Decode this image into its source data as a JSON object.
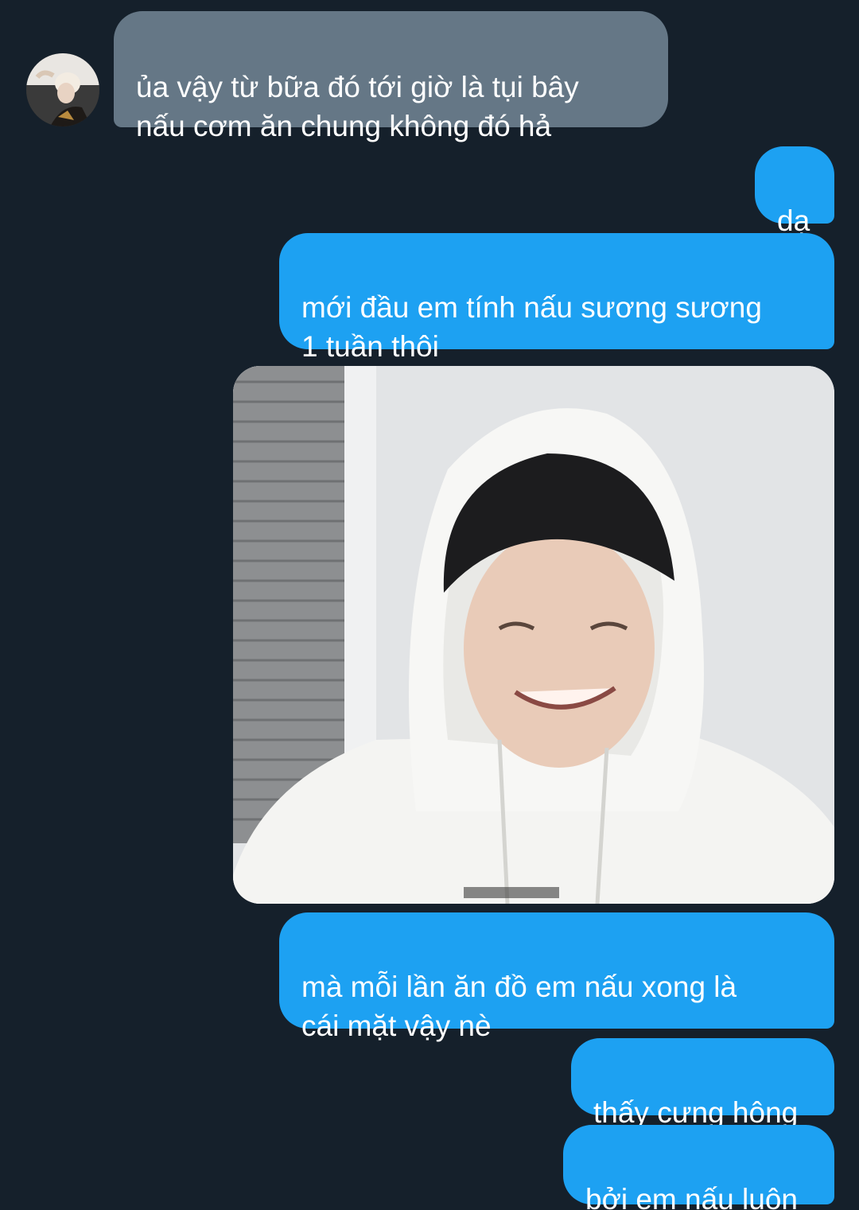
{
  "conversation": {
    "incoming": [
      {
        "text": "ủa vậy từ bữa đó tới giờ là tụi bây\nnấu cơm ăn chung không đó hả"
      }
    ],
    "outgoing": [
      {
        "text": "dạ"
      },
      {
        "text": "mới đầu em tính nấu sương sương\n1 tuần thôi"
      },
      {
        "text": "mà mỗi lần ăn đồ em nấu xong là\ncái mặt vậy nè"
      },
      {
        "text": "thấy cưng hông"
      },
      {
        "text": "bởi em nấu luôn"
      }
    ]
  },
  "colors": {
    "background": "#15202b",
    "incoming_bubble": "#657786",
    "outgoing_bubble": "#1da1f2",
    "text": "#ffffff"
  }
}
